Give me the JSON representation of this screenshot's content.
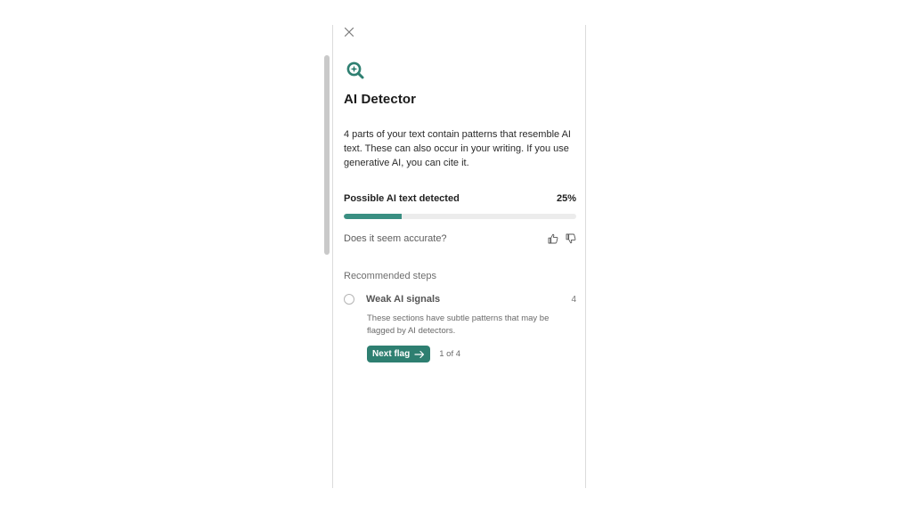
{
  "panel": {
    "title": "AI Detector",
    "description": "4 parts of your text contain patterns that resemble AI text. These can also occur in your writing. If you use generative AI, you can cite it.",
    "detection": {
      "label": "Possible AI text detected",
      "percent_text": "25%",
      "percent_value": 25
    },
    "accuracy_prompt": "Does it seem accurate?",
    "section_label": "Recommended steps",
    "step": {
      "title": "Weak AI signals",
      "count": "4",
      "description": "These sections have subtle patterns that may be flagged by AI detectors.",
      "button_label": "Next flag",
      "pager": "1 of 4"
    }
  },
  "icons": {
    "close": "close-icon",
    "logo": "ai-detector-search-icon",
    "thumbs_up": "thumbs-up-icon",
    "thumbs_down": "thumbs-down-icon",
    "arrow": "arrow-right-icon"
  },
  "colors": {
    "accent": "#2e7f71",
    "progress_fill": "#3a8f82",
    "progress_track": "#ececec"
  }
}
